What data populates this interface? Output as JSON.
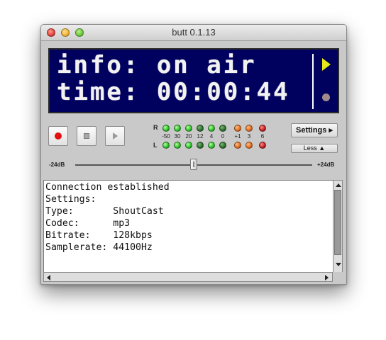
{
  "window": {
    "title": "butt 0.1.13"
  },
  "display": {
    "line1": "info: on air",
    "line2": "time: 00:00:44",
    "indicators": {
      "play_color": "#e3e81c",
      "record_color": "#a08b8b"
    }
  },
  "controls": {
    "record_icon": "record-icon",
    "stop_icon": "stop-icon",
    "play_icon": "play-icon"
  },
  "vu": {
    "right_label": "R",
    "left_label": "L",
    "scale": [
      "-50",
      "30",
      "20",
      "12",
      "4",
      "0",
      "+1",
      "3",
      "6"
    ],
    "colors": {
      "green": "#2bbd2b",
      "orange": "#e06a1c",
      "red": "#c21d1d"
    }
  },
  "buttons": {
    "settings_label": "Settings",
    "less_label": "Less"
  },
  "gain": {
    "min_label": "-24dB",
    "max_label": "+24dB"
  },
  "log": {
    "lines": [
      "Connection established",
      "Settings:",
      "Type:       ShoutCast",
      "Codec:      mp3",
      "Bitrate:    128kbps",
      "Samplerate: 44100Hz"
    ]
  }
}
